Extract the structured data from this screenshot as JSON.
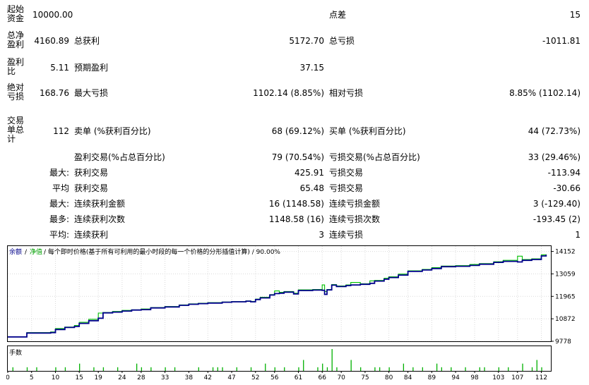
{
  "report": {
    "start_capital_label": "起始资金",
    "start_capital": "10000.00",
    "spread_label": "点差",
    "spread": "15",
    "net_profit_label": "总净盈利",
    "net_profit": "4160.89",
    "gross_profit_label": "总获利",
    "gross_profit": "5172.70",
    "gross_loss_label": "总亏损",
    "gross_loss": "-1011.81",
    "profit_factor_label": "盈利比",
    "profit_factor": "5.11",
    "expected_payoff_label": "预期盈利",
    "expected_payoff": "37.15",
    "abs_drawdown_label": "绝对亏损",
    "abs_drawdown": "168.76",
    "max_drawdown_label": "最大亏损",
    "max_drawdown": "1102.14 (8.85%)",
    "rel_drawdown_label": "相对亏损",
    "rel_drawdown": "8.85% (1102.14)",
    "total_trades_label": "交易单总计",
    "total_trades": "112",
    "short_label": "卖单 (%获利百分比)",
    "short_value": "68 (69.12%)",
    "long_label": "买单 (%获利百分比)",
    "long_value": "44 (72.73%)",
    "profit_trades_label": "盈利交易(%占总百分比)",
    "profit_trades": "79 (70.54%)",
    "loss_trades_label": "亏损交易(%占总百分比)",
    "loss_trades": "33 (29.46%)",
    "largest_prefix": "最大:",
    "largest_profit_label": "获利交易",
    "largest_profit": "425.91",
    "largest_loss_label": "亏损交易",
    "largest_loss": "-113.94",
    "average_prefix": "平均",
    "average_profit_label": "获利交易",
    "average_profit": "65.48",
    "average_loss_label": "亏损交易",
    "average_loss": "-30.66",
    "max_consec_prefix": "最大:",
    "max_consec_wins_label": "连续获利金额",
    "max_consec_wins": "16 (1148.58)",
    "max_consec_losses_label": "连续亏损金额",
    "max_consec_losses": "3 (-129.40)",
    "maximal_prefix": "最多:",
    "maximal_consec_profit_label": "连续获利次数",
    "maximal_consec_profit": "1148.58 (16)",
    "maximal_consec_loss_label": "连续亏损次数",
    "maximal_consec_loss": "-193.45 (2)",
    "avg_consec_prefix": "平均:",
    "avg_consec_wins_label": "连续获利",
    "avg_consec_wins": "3",
    "avg_consec_losses_label": "连续亏损",
    "avg_consec_losses": "1"
  },
  "chart": {
    "legend_balance": "余额",
    "legend_sep1": "/",
    "legend_equity": "净值",
    "legend_rest": "/ 每个即时价格(基于所有可利用的最小时段的每一个价格的分形插值计算) / 90.00%",
    "volume_label": "手数"
  },
  "colors": {
    "balance": "#00008b",
    "equity": "#00c000",
    "volume": "#00b000",
    "grid": "#d9d9d9",
    "frame": "#000000"
  },
  "chart_data": {
    "type": "line",
    "x_ticks": [
      0,
      5,
      10,
      15,
      19,
      24,
      28,
      33,
      38,
      42,
      47,
      52,
      56,
      61,
      66,
      70,
      75,
      80,
      84,
      89,
      94,
      98,
      103,
      107,
      112
    ],
    "y_ticks": [
      9778,
      10872,
      11965,
      13059,
      14152
    ],
    "ylim": [
      9778,
      14412
    ],
    "xlim": [
      0,
      114
    ],
    "series": [
      {
        "name": "余额",
        "x": [
          0,
          3,
          4,
          9,
          10,
          12,
          14,
          15,
          17,
          19,
          20,
          22,
          24,
          26,
          28,
          30,
          33,
          36,
          38,
          40,
          42,
          45,
          47,
          50,
          51,
          52,
          53,
          55,
          56,
          57,
          58,
          60,
          61,
          64,
          66,
          66.5,
          67,
          68,
          69,
          71,
          72,
          74,
          76,
          77,
          79,
          80,
          82,
          84,
          87,
          89,
          91,
          94,
          97,
          99,
          102,
          104,
          107,
          108,
          110,
          112,
          113
        ],
        "y": [
          9990,
          9990,
          10180,
          10200,
          10350,
          10450,
          10500,
          10650,
          10780,
          10900,
          11160,
          11200,
          11250,
          11300,
          11320,
          11400,
          11450,
          11530,
          11580,
          11610,
          11640,
          11680,
          11700,
          11730,
          11700,
          11810,
          11890,
          12030,
          12100,
          12120,
          12170,
          12080,
          12250,
          12270,
          12260,
          12060,
          12280,
          12510,
          12440,
          12490,
          12520,
          12550,
          12600,
          12710,
          12800,
          12880,
          13000,
          13180,
          13250,
          13320,
          13410,
          13430,
          13470,
          13530,
          13620,
          13670,
          13640,
          13720,
          13760,
          13930,
          13990
        ]
      },
      {
        "name": "净值",
        "x": [
          0,
          3,
          4,
          9,
          10,
          12,
          14,
          15,
          17,
          19,
          20,
          22,
          24,
          26,
          28,
          30,
          33,
          36,
          38,
          40,
          42,
          45,
          47,
          50,
          51,
          52,
          53,
          55,
          56,
          57,
          58,
          60,
          61,
          64,
          66,
          66.5,
          67,
          68,
          69,
          71,
          72,
          74,
          76,
          77,
          79,
          80,
          82,
          84,
          87,
          89,
          91,
          94,
          97,
          99,
          102,
          104,
          107,
          108,
          110,
          112,
          113
        ],
        "y": [
          9990,
          10000,
          10200,
          10230,
          10400,
          10470,
          10550,
          10700,
          10850,
          11150,
          11180,
          11230,
          11280,
          11310,
          11350,
          11420,
          11470,
          11550,
          11600,
          11630,
          11660,
          11690,
          11710,
          11740,
          11720,
          11830,
          11920,
          12050,
          12230,
          12160,
          12200,
          12120,
          12280,
          12300,
          12520,
          12200,
          12300,
          12540,
          12470,
          12520,
          12640,
          12580,
          12720,
          12740,
          12850,
          12920,
          13050,
          13210,
          13280,
          13360,
          13440,
          13460,
          13520,
          13560,
          13650,
          13720,
          13920,
          13760,
          13790,
          13990,
          14010
        ]
      }
    ],
    "volume": [
      0,
      1,
      0,
      0,
      1,
      0,
      1,
      0,
      0,
      0,
      1,
      0,
      1,
      0,
      0,
      2,
      0,
      0,
      1,
      0,
      1,
      0,
      0,
      1,
      0,
      0,
      0,
      2,
      1,
      0,
      1,
      0,
      0,
      1,
      0,
      1,
      0,
      0,
      0,
      0,
      1,
      0,
      0,
      1,
      1,
      1,
      0,
      0,
      1,
      0,
      0,
      1,
      0,
      0,
      2,
      0,
      1,
      0,
      1,
      0,
      0,
      1,
      3,
      0,
      0,
      1,
      2,
      1,
      6,
      1,
      0,
      0,
      3,
      0,
      1,
      0,
      0,
      1,
      1,
      0,
      1,
      0,
      0,
      2,
      0,
      1,
      0,
      1,
      0,
      0,
      2,
      1,
      0,
      1,
      0,
      0,
      1,
      0,
      0,
      1,
      1,
      0,
      0,
      1,
      0,
      1,
      0,
      0,
      2,
      0,
      1,
      3,
      1
    ]
  }
}
